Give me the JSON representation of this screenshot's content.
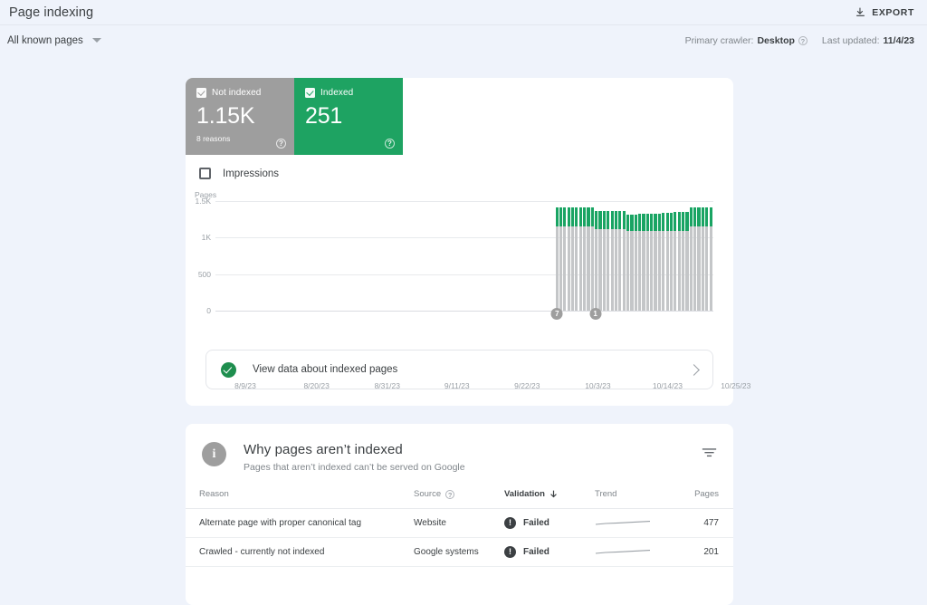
{
  "header": {
    "title": "Page indexing",
    "export_label": "EXPORT",
    "export_icon": "download-icon"
  },
  "filters": {
    "scope_selected": "All known pages",
    "caret_icon": "chevron-down-icon",
    "primary_crawler_label": "Primary crawler:",
    "primary_crawler_value": "Desktop",
    "crawler_help_icon": "help-icon",
    "last_updated_label": "Last updated:",
    "last_updated_value": "11/4/23"
  },
  "summary": {
    "tiles": [
      {
        "label": "Not indexed",
        "value": "1.15K",
        "sub": "8 reasons",
        "color": "#9e9e9e",
        "checkbox_icon": "checkbox-checked-icon",
        "help_icon": "help-icon"
      },
      {
        "label": "Indexed",
        "value": "251",
        "sub": "",
        "color": "#1ea362",
        "checkbox_icon": "checkbox-checked-icon",
        "help_icon": "help-icon"
      }
    ],
    "impressions_label": "Impressions",
    "impressions_checked": false
  },
  "chart_data": {
    "type": "bar",
    "title": "",
    "ylabel": "Pages",
    "xlabel": "",
    "ylim": [
      0,
      1500
    ],
    "ytick_labels": [
      "0",
      "500",
      "1K",
      "1.5K"
    ],
    "ytick_values": [
      0,
      500,
      1000,
      1500
    ],
    "grid": true,
    "stacked": true,
    "legend_position": "none",
    "x_tick_labels": [
      "8/9/23",
      "8/20/23",
      "8/31/23",
      "9/11/23",
      "9/22/23",
      "10/3/23",
      "10/14/23",
      "10/25/23"
    ],
    "x_tick_positions_pct": [
      6.0,
      20.3,
      34.5,
      48.5,
      62.6,
      76.8,
      90.8,
      104.5
    ],
    "data_start_pct": 67.5,
    "data_end_pct": 99.0,
    "series": [
      {
        "name": "Not indexed",
        "color": "#c4c6c8",
        "values": [
          1150,
          1150,
          1150,
          1150,
          1150,
          1150,
          1150,
          1150,
          1150,
          1150,
          1120,
          1120,
          1120,
          1120,
          1120,
          1120,
          1120,
          1120,
          1090,
          1090,
          1090,
          1090,
          1090,
          1090,
          1090,
          1090,
          1090,
          1090,
          1090,
          1090,
          1090,
          1090,
          1090,
          1090,
          1150,
          1150,
          1150,
          1150,
          1150,
          1150
        ]
      },
      {
        "name": "Indexed",
        "color": "#19a463",
        "values": [
          258,
          258,
          258,
          258,
          258,
          258,
          258,
          258,
          258,
          258,
          240,
          240,
          240,
          240,
          240,
          240,
          240,
          240,
          228,
          228,
          228,
          232,
          232,
          232,
          236,
          236,
          240,
          244,
          248,
          252,
          256,
          258,
          260,
          262,
          268,
          268,
          268,
          268,
          268,
          268
        ]
      }
    ],
    "annotations": [
      {
        "label": "7",
        "x_pct": 68.6
      },
      {
        "label": "1",
        "x_pct": 76.3
      }
    ]
  },
  "view_data_row": {
    "label": "View data about indexed pages",
    "status_icon": "check-circle-icon",
    "chevron_icon": "chevron-right-icon"
  },
  "reasons": {
    "info_icon": "info-icon",
    "title": "Why pages aren’t indexed",
    "subtitle": "Pages that aren’t indexed can’t be served on Google",
    "filter_icon": "filter-icon",
    "columns": [
      "Reason",
      "Source",
      "Validation",
      "Trend",
      "Pages"
    ],
    "source_help_icon": "help-icon",
    "sort_column": "Validation",
    "sort_icon": "arrow-down-icon",
    "rows": [
      {
        "reason": "Alternate page with proper canonical tag",
        "source": "Website",
        "validation": "Failed",
        "validation_icon": "error-icon",
        "trend_icon": "sparkline-flat",
        "pages": "477"
      },
      {
        "reason": "Crawled - currently not indexed",
        "source": "Google systems",
        "validation": "Failed",
        "validation_icon": "error-icon",
        "trend_icon": "sparkline-flat",
        "pages": "201"
      }
    ]
  },
  "colors": {
    "background": "#eff3fb",
    "card": "#ffffff",
    "indexed_green": "#1ea362",
    "not_indexed_gray": "#9e9e9e",
    "text_primary": "#3c4043",
    "text_secondary": "#80868b"
  }
}
